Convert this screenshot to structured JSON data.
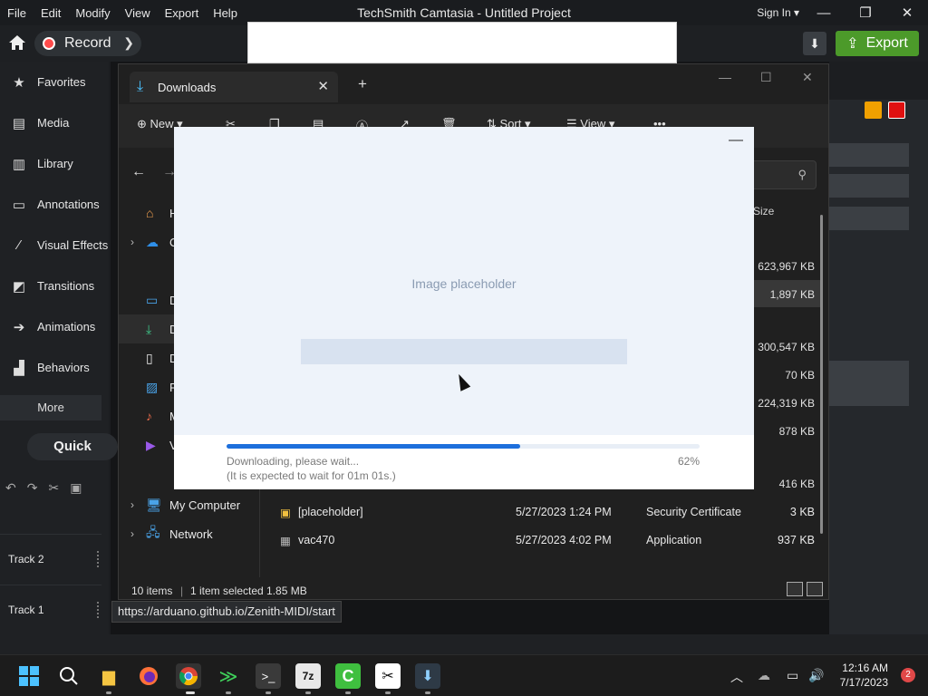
{
  "camtasia": {
    "menu": [
      "File",
      "Edit",
      "Modify",
      "View",
      "Export",
      "Help"
    ],
    "title": "TechSmith Camtasia - Untitled Project",
    "sign_in": "Sign In",
    "record_label": "Record",
    "export_label": "Export",
    "sidebar": [
      {
        "label": "Favorites",
        "icon": "star-icon"
      },
      {
        "label": "Media",
        "icon": "film-icon"
      },
      {
        "label": "Library",
        "icon": "books-icon"
      },
      {
        "label": "Annotations",
        "icon": "annotation-icon"
      },
      {
        "label": "Visual Effects",
        "icon": "wand-icon"
      },
      {
        "label": "Transitions",
        "icon": "transition-icon"
      },
      {
        "label": "Animations",
        "icon": "arrow-icon"
      },
      {
        "label": "Behaviors",
        "icon": "bars-icon"
      }
    ],
    "more_label": "More",
    "quick_label": "Quick",
    "tracks": [
      "Track 2",
      "Track 1"
    ]
  },
  "explorer": {
    "tab_label": "Downloads",
    "commands": {
      "new": "New",
      "sort": "Sort",
      "view": "View"
    },
    "nav": [
      {
        "label": "H",
        "icon": "home-icon",
        "chevron": false
      },
      {
        "label": "O",
        "icon": "cloud-icon",
        "chevron": true
      },
      {
        "label": "D",
        "icon": "desktop-icon",
        "chevron": false
      },
      {
        "label": "D",
        "icon": "download-icon",
        "chevron": false,
        "selected": true
      },
      {
        "label": "D",
        "icon": "document-icon",
        "chevron": false
      },
      {
        "label": "P",
        "icon": "picture-icon",
        "chevron": false
      },
      {
        "label": "M",
        "icon": "music-icon",
        "chevron": false
      },
      {
        "label": "V",
        "icon": "video-icon",
        "chevron": false
      },
      {
        "label": "My Computer",
        "icon": "computer-icon",
        "chevron": true
      },
      {
        "label": "Network",
        "icon": "network-icon",
        "chevron": true
      }
    ],
    "size_header": "Size",
    "sizes": [
      "623,967 KB",
      "1,897 KB",
      "300,547 KB",
      "70 KB",
      "224,319 KB",
      "878 KB",
      "416 KB"
    ],
    "files": [
      {
        "name": "[placeholder]",
        "date": "5/27/2023 1:24 PM",
        "type": "Security Certificate",
        "size": "3 KB"
      },
      {
        "name": "vac470",
        "date": "5/27/2023 4:02 PM",
        "type": "Application",
        "size": "937 KB"
      }
    ],
    "status": {
      "items": "10 items",
      "selected": "1 item selected  1.85 MB"
    }
  },
  "dialog": {
    "status_text": "Downloading, please wait...",
    "eta_text": "(It is expected to wait for 01m 01s.)",
    "percent_label": "62%",
    "progress": 0.62
  },
  "tooltip_url": "https://arduano.github.io/Zenith-MIDI/start",
  "taskbar": {
    "time": "12:16 AM",
    "date": "7/17/2023",
    "notifications": "2"
  },
  "colors": {
    "accent": "#4c9a2a",
    "record": "#ff4b4b",
    "progress": "#1d6fdc"
  }
}
